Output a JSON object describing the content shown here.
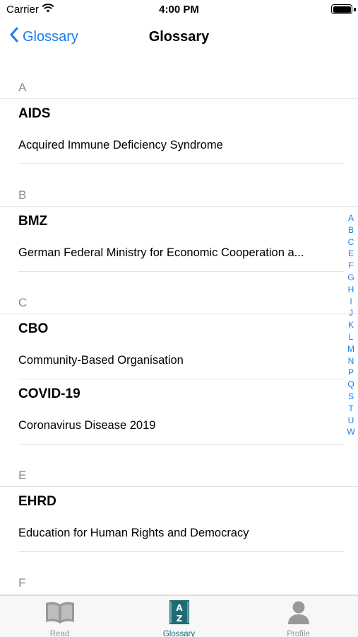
{
  "status_bar": {
    "carrier": "Carrier",
    "time": "4:00 PM"
  },
  "nav": {
    "back_label": "Glossary",
    "title": "Glossary"
  },
  "sections": [
    {
      "letter": "A",
      "entries": [
        {
          "term": "AIDS",
          "definition": "Acquired Immune Deficiency Syndrome"
        }
      ]
    },
    {
      "letter": "B",
      "entries": [
        {
          "term": "BMZ",
          "definition": "German Federal Ministry for Economic Cooperation a..."
        }
      ]
    },
    {
      "letter": "C",
      "entries": [
        {
          "term": "CBO",
          "definition": "Community-Based Organisation"
        },
        {
          "term": "COVID-19",
          "definition": "Coronavirus Disease 2019"
        }
      ]
    },
    {
      "letter": "E",
      "entries": [
        {
          "term": "EHRD",
          "definition": "Education for Human Rights and Democracy"
        }
      ]
    },
    {
      "letter": "F",
      "entries": []
    }
  ],
  "index": [
    "A",
    "B",
    "C",
    "E",
    "F",
    "G",
    "H",
    "I",
    "J",
    "K",
    "L",
    "M",
    "N",
    "P",
    "Q",
    "S",
    "T",
    "U",
    "W"
  ],
  "tabs": [
    {
      "label": "Read",
      "icon": "book-icon",
      "active": false
    },
    {
      "label": "Glossary",
      "icon": "glossary-az-icon",
      "active": true
    },
    {
      "label": "Profile",
      "icon": "person-icon",
      "active": false
    }
  ],
  "colors": {
    "accent": "#1a7cf0",
    "active_tab": "#1f6b74",
    "inactive_tab": "#999999",
    "section_letter": "#8a8a8e"
  }
}
